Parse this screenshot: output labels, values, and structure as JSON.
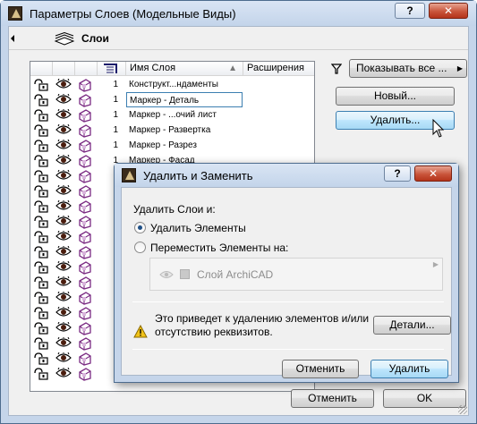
{
  "window": {
    "title": "Параметры Слоев (Модельные Виды)",
    "help_label": "?",
    "close_label": "✕"
  },
  "section": {
    "title": "Слои"
  },
  "table": {
    "columns": [
      "Имя Слоя",
      "Расширения"
    ],
    "rows": [
      {
        "num": "1",
        "name": "Конструкт...ндаменты",
        "selected": false
      },
      {
        "num": "1",
        "name": "Маркер - Деталь",
        "selected": true
      },
      {
        "num": "1",
        "name": "Маркер - ...очий лист",
        "selected": false
      },
      {
        "num": "1",
        "name": "Маркер - Развертка",
        "selected": false
      },
      {
        "num": "1",
        "name": "Маркер - Разрез",
        "selected": false
      },
      {
        "num": "1",
        "name": "Маркер - Фасад",
        "selected": false
      },
      {
        "num": "",
        "name": "",
        "selected": false
      },
      {
        "num": "",
        "name": "",
        "selected": false
      },
      {
        "num": "",
        "name": "",
        "selected": false
      },
      {
        "num": "",
        "name": "",
        "selected": false
      },
      {
        "num": "",
        "name": "",
        "selected": false
      },
      {
        "num": "",
        "name": "",
        "selected": false
      },
      {
        "num": "",
        "name": "",
        "selected": false
      },
      {
        "num": "",
        "name": "",
        "selected": false
      },
      {
        "num": "",
        "name": "",
        "selected": false
      },
      {
        "num": "",
        "name": "",
        "selected": false
      },
      {
        "num": "",
        "name": "",
        "selected": false
      },
      {
        "num": "",
        "name": "",
        "selected": false
      },
      {
        "num": "",
        "name": "",
        "selected": false
      },
      {
        "num": "",
        "name": "",
        "selected": false
      }
    ]
  },
  "side": {
    "filter_label": "Показывать все ...",
    "new_label": "Новый...",
    "delete_label": "Удалить..."
  },
  "footer": {
    "cancel_label": "Отменить",
    "ok_label": "OK"
  },
  "dialog": {
    "title": "Удалить и Заменить",
    "help_label": "?",
    "close_label": "✕",
    "prompt": "Удалить Слои и:",
    "option_delete": "Удалить Элементы",
    "option_move": "Переместить Элементы на:",
    "target_layer": "Слой ArchiCAD",
    "warning_line1": "Это приведет к удалению элементов и/или",
    "warning_line2": "отсутствию реквизитов.",
    "details_label": "Детали...",
    "cancel_label": "Отменить",
    "delete_label": "Удалить"
  },
  "colors": {
    "frame": "#c5d5ea",
    "focus_border": "#3c7fb1",
    "close_red": "#c9553b",
    "wire_purple": "#7a2a82",
    "warning_yellow": "#f2c318"
  },
  "icons": [
    "lock-open-icon",
    "eye-icon",
    "wireframe-layer-icon",
    "filter-icon",
    "layers-icon",
    "warning-icon",
    "mouse-cursor-icon"
  ]
}
